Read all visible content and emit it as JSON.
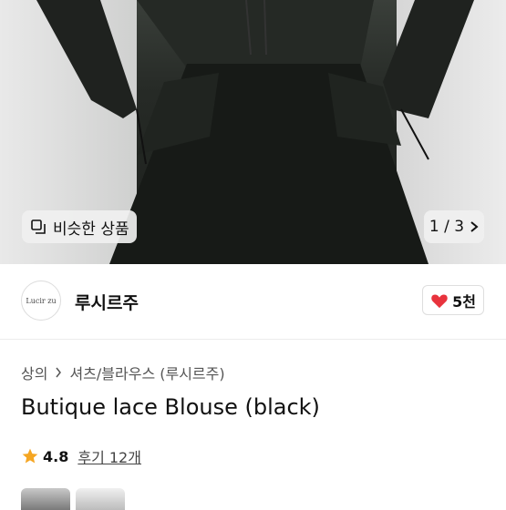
{
  "hero": {
    "similar_label": "비슷한 상품",
    "pager_current": "1",
    "pager_total": "3",
    "pager_text": "1 / 3"
  },
  "shop": {
    "logo_text": "Lucir zu",
    "name": "루시르주",
    "like_count": "5천"
  },
  "breadcrumb": {
    "category": "상의",
    "subcategory": "셔츠/블라우스 (루시르주)"
  },
  "product": {
    "title": "Butique lace Blouse (black)",
    "rating": "4.8",
    "reviews_label": "후기 12개"
  },
  "colors": {
    "like_heart": "#e8333d",
    "star": "#f5a623"
  }
}
